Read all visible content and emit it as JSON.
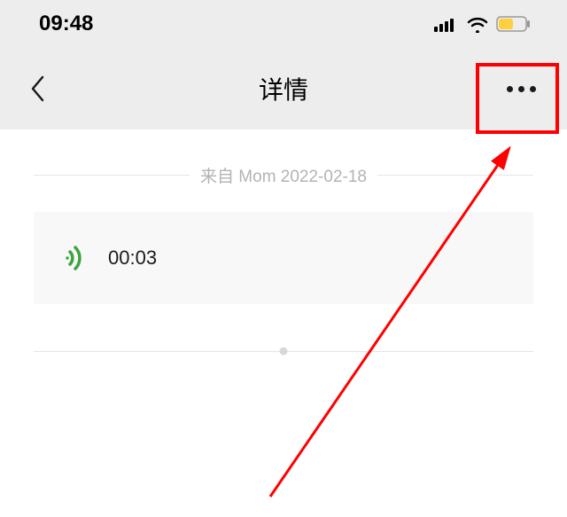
{
  "status_bar": {
    "time": "09:48"
  },
  "nav": {
    "title": "详情"
  },
  "meta": {
    "from_label": "来自 Mom 2022-02-18"
  },
  "voice": {
    "duration": "00:03"
  }
}
